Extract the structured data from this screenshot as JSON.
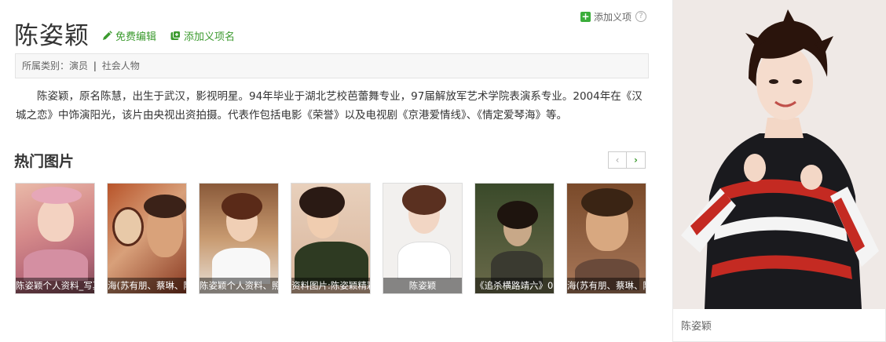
{
  "header": {
    "title": "陈姿颖",
    "edit_label": "免费编辑",
    "add_meaning_label": "添加义项名",
    "add_sense_label": "添加义项",
    "help_glyph": "?"
  },
  "category": {
    "label": "所属类别：",
    "items": [
      "演员",
      "社会人物"
    ],
    "separator": "|"
  },
  "summary": "陈姿颖，原名陈慧，出生于武汉，影视明星。94年毕业于湖北艺校芭蕾舞专业，97届解放军艺术学院表演系专业。2004年在《汉城之恋》中饰演阳光，该片由央视出资拍摄。代表作包括电影《荣誉》以及电视剧《京港爱情线》、《情定爱琴海》等。",
  "gallery": {
    "title": "热门图片",
    "prev": "‹",
    "next": "›",
    "items": [
      {
        "caption": "陈姿颖个人资料_写真"
      },
      {
        "caption": "海(苏有朋、蔡琳、陈姿"
      },
      {
        "caption": "陈姿颖个人资料、照片"
      },
      {
        "caption": "资料图片:陈姿颖精彩"
      },
      {
        "caption": "陈姿颖"
      },
      {
        "caption": "《追杀横路靖六》0"
      },
      {
        "caption": "海(苏有朋、蔡琳、陈姿"
      }
    ]
  },
  "sidebar": {
    "caption": "陈姿颖"
  },
  "colors": {
    "accent_green": "#3b9a2e",
    "plus_green": "#3bae3b",
    "category_bg": "#f7f7f7"
  }
}
